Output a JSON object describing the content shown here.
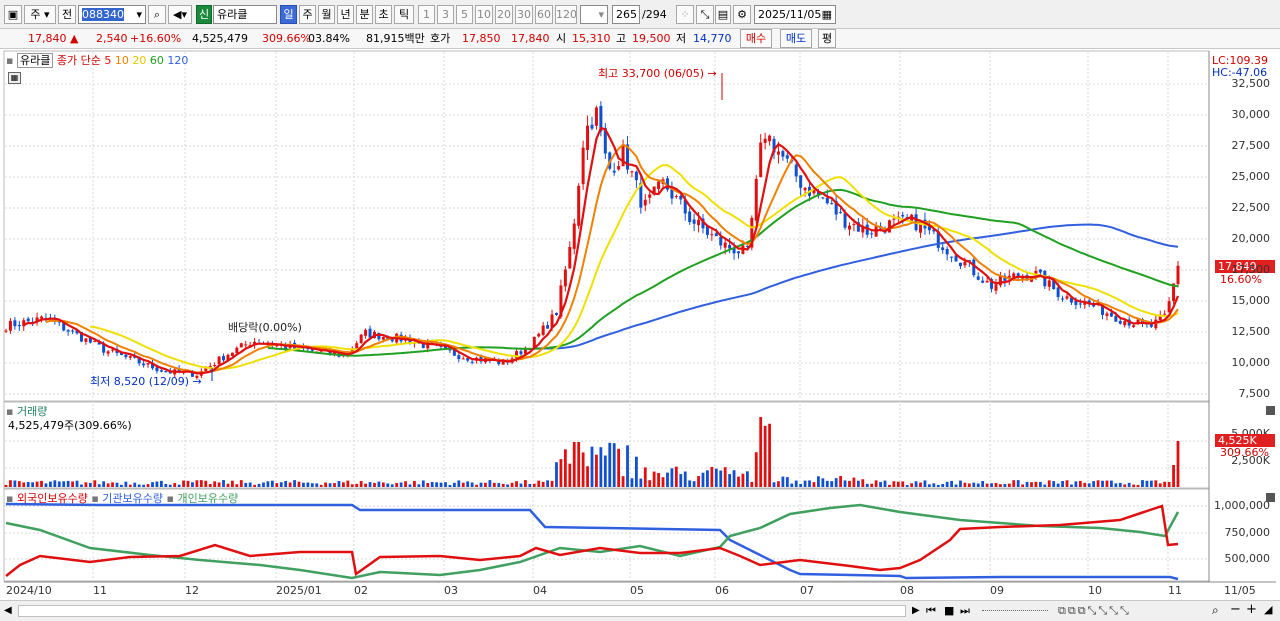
{
  "toolbar": {
    "market": "주",
    "prev_label": "전",
    "code": "088340",
    "new_badge": "신",
    "name": "유라클",
    "periods": [
      "일",
      "주",
      "월",
      "년",
      "분",
      "초",
      "틱"
    ],
    "numbers": [
      "1",
      "3",
      "5",
      "10",
      "20",
      "30",
      "60",
      "120"
    ],
    "count": "265",
    "total": "/294",
    "date": "2025/11/05"
  },
  "quote": {
    "price": "17,840",
    "change": "2,540",
    "change_pct": "+16.60%",
    "volume": "4,525,479",
    "volume_ratio": "309.66%",
    "turnover": "03.84%",
    "amount": "81,915백만",
    "hoga_label": "호가",
    "ask": "17,850",
    "bid": "17,840",
    "open_label": "시",
    "open": "15,310",
    "high_label": "고",
    "high": "19,500",
    "low_label": "저",
    "low": "14,770",
    "buy_label": "매수",
    "sell_label": "매도",
    "avg_label": "평"
  },
  "price_panel": {
    "stock_name": "유라클",
    "ma_prefix": "종가 단순",
    "ma_periods": [
      "5",
      "10",
      "20",
      "60",
      "120"
    ],
    "lc": "LC:109.39",
    "hc": "HC:-47.06",
    "high_marker": "최고 33,700 (06/05)",
    "low_marker": "최저 8,520 (12/09)",
    "dividend": "배당락(0.00%)",
    "price_tag": "17,840",
    "pct_tag": "16.60%",
    "y_ticks": [
      "32,500",
      "30,000",
      "27,500",
      "25,000",
      "22,500",
      "20,000",
      "17,500",
      "15,000",
      "12,500",
      "10,000",
      "7,500"
    ]
  },
  "volume_panel": {
    "title": "거래량",
    "value": "4,525,479주(309.66%)",
    "tag": "4,525K",
    "pct": "309.66%",
    "y_ticks": [
      "5,000K",
      "2,500K"
    ]
  },
  "holder_panel": {
    "series": [
      "외국인보유수량",
      "기관보유수량",
      "개인보유수량"
    ],
    "y_ticks": [
      "1,000,000",
      "750,000",
      "500,000"
    ]
  },
  "x_axis": [
    "2024/10",
    "11",
    "12",
    "2025/01",
    "02",
    "03",
    "04",
    "05",
    "06",
    "07",
    "08",
    "09",
    "10",
    "11",
    "11/05"
  ],
  "colors": {
    "ma5": "#e01010",
    "ma10": "#f08000",
    "ma20": "#f0e000",
    "ma60": "#20a020",
    "ma120": "#3060e0",
    "up": "#e01010",
    "down": "#1050d0",
    "foreign": "#e01010",
    "institution": "#3060e0",
    "individual": "#40a060"
  }
}
